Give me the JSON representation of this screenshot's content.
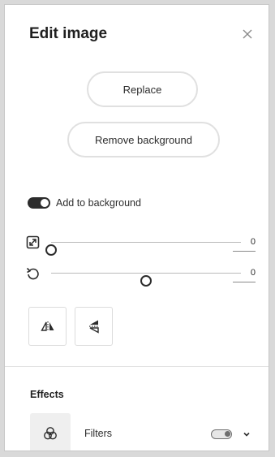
{
  "panel": {
    "title": "Edit image"
  },
  "actions": {
    "replace_label": "Replace",
    "remove_background_label": "Remove background"
  },
  "add_to_background": {
    "label": "Add to background",
    "enabled": true
  },
  "scale": {
    "icon": "resize-icon",
    "value": "0",
    "slider_fraction": 0.0
  },
  "rotate": {
    "icon": "rotate-icon",
    "value": "0",
    "slider_fraction": 0.5
  },
  "flip": {
    "horizontal_icon": "flip-horizontal-icon",
    "vertical_icon": "flip-vertical-icon"
  },
  "effects": {
    "title": "Effects",
    "filters": {
      "label": "Filters",
      "icon": "filters-icon",
      "enabled": false
    }
  },
  "colors": {
    "text": "#2c2c2c",
    "track": "#b9b9b9",
    "border": "#e0e0e0"
  }
}
